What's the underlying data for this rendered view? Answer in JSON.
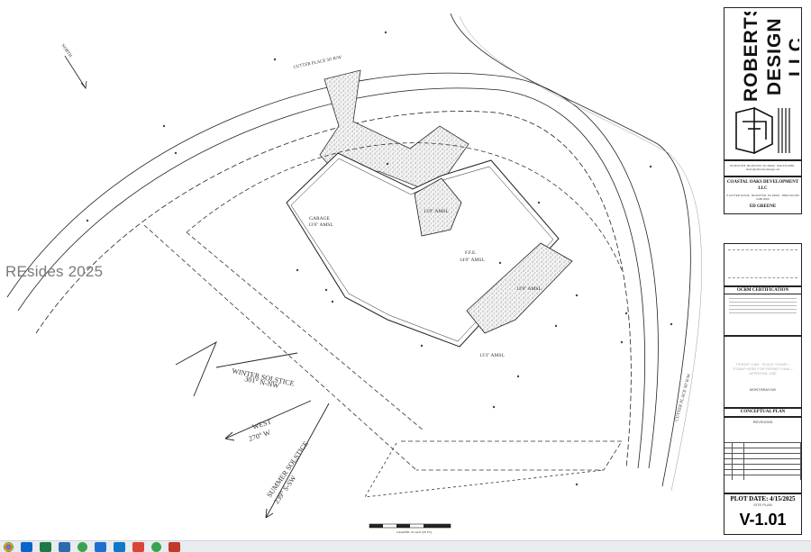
{
  "watermark": "REsides 2025",
  "plan": {
    "street_north": "CUTTER PLACE  50' R/W",
    "street_east": "CUTTER PLACE  50' R/W",
    "north_label": "NORTH",
    "garage_label": "GARAGE",
    "garage_elev": "13'6\" AMSL",
    "ffe_label": "F.F.E.",
    "ffe_elev": "14'0\" AMSL",
    "porch1_elev": "13'9\" AMSL",
    "porch2_elev": "13'9\" AMSL",
    "grade_elev": "13'3\" AMSL",
    "winter_solstice": "WINTER SOLSTICE",
    "winter_bearing": "301° N-NW",
    "west": "WEST",
    "west_bearing": "270° W",
    "summer_solstice": "SUMMER SOLSTICE",
    "summer_bearing": "239° S-SW",
    "scale_label": "GRAPHIC SCALE (IN FT)"
  },
  "title_block": {
    "firm_line1": "ROBERTSON",
    "firm_line2": "DESIGN LLC",
    "firm_contact": "PO BOX 875, BLUFFTON, SC 29910 · 843-476-2655 · dustin@robertsondesign.net",
    "client_name": "COASTAL OAKS DEVELOPMENT LLC",
    "client_address": "5 CUTTER PLACE · BLUFFTON, SC 29910 · R600 013 000 0185 0000",
    "client_contact": "ED GREENE",
    "ocrm_title": "OCRM CERTIFICATION",
    "permit_note": "PERMIT 1465 · PLACE STAMP / STAMP HERE FOR PERMIT FINAL / APPROVAL USE",
    "owner_label": "MONTHRAY/UK",
    "conceptual": "CONCEPTUAL PLAN",
    "revisions_title": "REVISIONS",
    "plot_date": "PLOT DATE: 4/15/2025",
    "sheet_title": "SITE PLAN",
    "sheet_number": "V-1.01"
  },
  "taskbar": {
    "icons": [
      "chrome-icon",
      "outlook-icon",
      "excel-icon",
      "calendar-icon",
      "teams-icon",
      "files-icon",
      "edge-icon",
      "maps-icon",
      "teams-2-icon",
      "pdf-icon"
    ]
  }
}
